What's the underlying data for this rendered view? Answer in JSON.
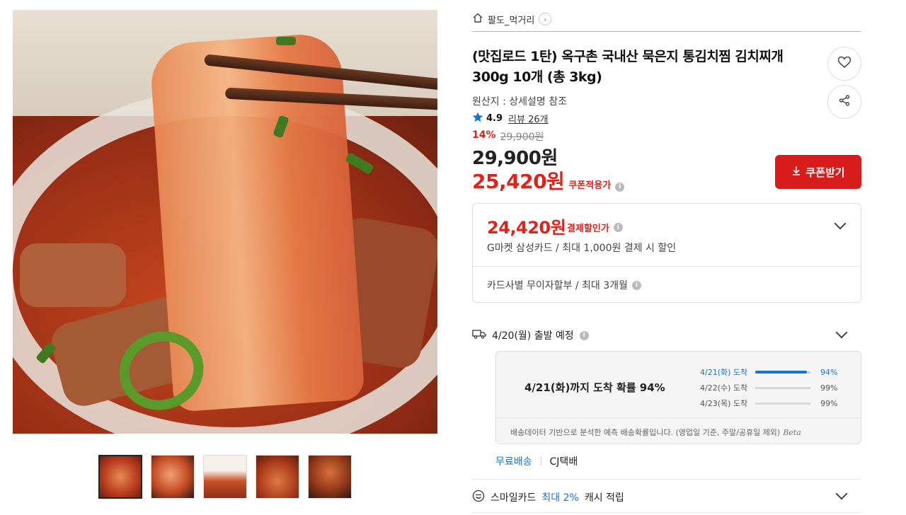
{
  "breadcrumb": {
    "store": "팔도_먹거리"
  },
  "product": {
    "title": "(맛집로드 1탄) 옥구촌 국내산 묵은지 통김치찜 김치찌개 300g 10개 (총 3kg)",
    "origin": "원산지 : 상세설명 참조",
    "rating": "4.9",
    "review_label": "리뷰 26개",
    "discount_pct": "14%",
    "original_price": "29,900원",
    "price": "29,900원",
    "coupon_price": "25,420원",
    "coupon_price_label": "쿠폰적용가",
    "coupon_button": "쿠폰받기"
  },
  "payment": {
    "price": "24,420원",
    "label": "결제할인가",
    "detail": "G마켓 삼성카드 / 최대 1,000원 결제 시 할인",
    "installment": "카드사별 무이자할부 / 최대 3개월"
  },
  "shipping": {
    "departure": "4/20(월) 출발 예정",
    "headline": "4/21(화)까지 도착 확률 94%",
    "rows": [
      {
        "date": "4/21(화) 도착",
        "pct": "94%",
        "value": 0.94
      },
      {
        "date": "4/22(수) 도착",
        "pct": "99%",
        "value": 0.99
      },
      {
        "date": "4/23(목) 도착",
        "pct": "99%",
        "value": 0.99
      }
    ],
    "note": "배송데이터 기반으로 분석한 예측 배송확률입니다. (영업일 기준, 주말/공휴일 제외)",
    "beta": "Beta",
    "free_label": "무료배송",
    "carrier": "CJ택배"
  },
  "smilecard": {
    "prefix": "스마일카드",
    "highlight": "최대 2%",
    "suffix": "캐시 적립"
  },
  "thumbnails": [
    "thumb-1",
    "thumb-2",
    "thumb-3",
    "thumb-4",
    "thumb-5"
  ],
  "colors": {
    "accent_red": "#e0221b",
    "button_red": "#d81b1b",
    "accent_blue": "#1a73c9"
  }
}
